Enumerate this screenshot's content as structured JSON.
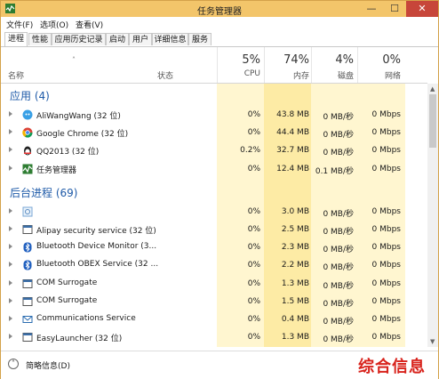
{
  "window": {
    "title": "任务管理器",
    "minimize_glyph": "—",
    "maximize_glyph": "☐",
    "close_glyph": "✕"
  },
  "menu": [
    "文件(F)",
    "选项(O)",
    "查看(V)"
  ],
  "tabs": [
    "进程",
    "性能",
    "应用历史记录",
    "启动",
    "用户",
    "详细信息",
    "服务"
  ],
  "active_tab": "进程",
  "columns": {
    "name": "名称",
    "status": "状态",
    "cpu": {
      "pct": "5%",
      "label": "CPU"
    },
    "memory": {
      "pct": "74%",
      "label": "内存"
    },
    "disk": {
      "pct": "4%",
      "label": "磁盘"
    },
    "network": {
      "pct": "0%",
      "label": "网络"
    }
  },
  "groups": [
    {
      "title": "应用 (4)",
      "rows": [
        {
          "name": "AliWangWang (32 位)",
          "icon": "aliwangwang-icon",
          "cpu": "0%",
          "mem": "43.8 MB",
          "disk": "0 MB/秒",
          "net": "0 Mbps"
        },
        {
          "name": "Google Chrome (32 位)",
          "icon": "chrome-icon",
          "cpu": "0%",
          "mem": "44.4 MB",
          "disk": "0 MB/秒",
          "net": "0 Mbps"
        },
        {
          "name": "QQ2013 (32 位)",
          "icon": "qq-icon",
          "cpu": "0.2%",
          "mem": "32.7 MB",
          "disk": "0 MB/秒",
          "net": "0 Mbps"
        },
        {
          "name": "任务管理器",
          "icon": "task-manager-icon",
          "cpu": "0%",
          "mem": "12.4 MB",
          "disk": "0.1 MB/秒",
          "net": "0 Mbps"
        }
      ]
    },
    {
      "title": "后台进程 (69)",
      "rows": [
        {
          "name": "",
          "icon": "generic-process-icon",
          "cpu": "0%",
          "mem": "3.0 MB",
          "disk": "0 MB/秒",
          "net": "0 Mbps"
        },
        {
          "name": "Alipay security service (32 位)",
          "icon": "service-icon",
          "cpu": "0%",
          "mem": "2.5 MB",
          "disk": "0 MB/秒",
          "net": "0 Mbps"
        },
        {
          "name": "Bluetooth Device Monitor (3...",
          "icon": "bluetooth-icon",
          "cpu": "0%",
          "mem": "2.3 MB",
          "disk": "0 MB/秒",
          "net": "0 Mbps"
        },
        {
          "name": "Bluetooth OBEX Service (32 ...",
          "icon": "bluetooth-icon",
          "cpu": "0%",
          "mem": "2.2 MB",
          "disk": "0 MB/秒",
          "net": "0 Mbps"
        },
        {
          "name": "COM Surrogate",
          "icon": "service-icon",
          "cpu": "0%",
          "mem": "1.3 MB",
          "disk": "0 MB/秒",
          "net": "0 Mbps"
        },
        {
          "name": "COM Surrogate",
          "icon": "service-icon",
          "cpu": "0%",
          "mem": "1.5 MB",
          "disk": "0 MB/秒",
          "net": "0 Mbps"
        },
        {
          "name": "Communications Service",
          "icon": "mail-icon",
          "cpu": "0%",
          "mem": "0.4 MB",
          "disk": "0 MB/秒",
          "net": "0 Mbps"
        },
        {
          "name": "EasyLauncher (32 位)",
          "icon": "service-icon",
          "cpu": "0%",
          "mem": "1.3 MB",
          "disk": "0 MB/秒",
          "net": "0 Mbps"
        }
      ]
    }
  ],
  "footer": {
    "label": "简略信息(D)",
    "icon": "chevron-up-circle-icon"
  },
  "watermark": "综合信息",
  "colors": {
    "title_bar": "#f3c56a",
    "group_title": "#1e5aa8",
    "cpu_col": "#fff6d0",
    "mem_col": "#fdeba5",
    "close_button": "#c7463a"
  }
}
